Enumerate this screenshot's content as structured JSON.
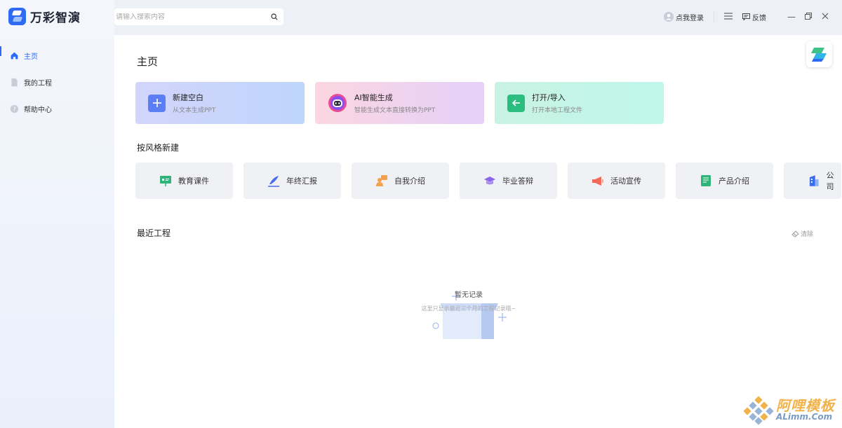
{
  "app": {
    "name": "万彩智演"
  },
  "sidebar": {
    "items": [
      {
        "label": "主页",
        "icon": "home-icon",
        "active": true
      },
      {
        "label": "我的工程",
        "icon": "file-icon",
        "active": false
      },
      {
        "label": "帮助中心",
        "icon": "help-icon",
        "active": false
      }
    ]
  },
  "topbar": {
    "search_placeholder": "请输入搜索内容",
    "login_label": "点我登录",
    "feedback_label": "反馈"
  },
  "main": {
    "title": "主页",
    "cards": [
      {
        "title": "新建空白",
        "subtitle": "从文本生成PPT",
        "icon": "plus-icon",
        "color": "#5b7ef5"
      },
      {
        "title": "AI智能生成",
        "subtitle": "智能生成文本直接转换为PPT",
        "icon": "robot-icon",
        "color": "#e94a94"
      },
      {
        "title": "打开/导入",
        "subtitle": "打开本地工程文件",
        "icon": "import-icon",
        "color": "#2bbd7e"
      }
    ],
    "style_section_title": "按风格新建",
    "styles": [
      {
        "label": "教育课件",
        "icon": "board-icon",
        "color": "#2fb579"
      },
      {
        "label": "年终汇报",
        "icon": "pen-icon",
        "color": "#4a6cf0"
      },
      {
        "label": "自我介绍",
        "icon": "person-icon",
        "color": "#f5a04a"
      },
      {
        "label": "毕业答辩",
        "icon": "graduation-cap-icon",
        "color": "#8a66e8"
      },
      {
        "label": "活动宣传",
        "icon": "megaphone-icon",
        "color": "#f26a5a"
      },
      {
        "label": "产品介绍",
        "icon": "document-icon",
        "color": "#2fb579"
      },
      {
        "label": "公司",
        "icon": "building-icon",
        "color": "#3a6cf0"
      }
    ],
    "recent_title": "最近工程",
    "clear_label": "清除",
    "empty_title": "暂无记录",
    "empty_sub": "这里只显示最近三个月的工程记录哦~"
  },
  "watermark": {
    "top": "阿哩模板",
    "bottom": "ALimm.Com"
  }
}
